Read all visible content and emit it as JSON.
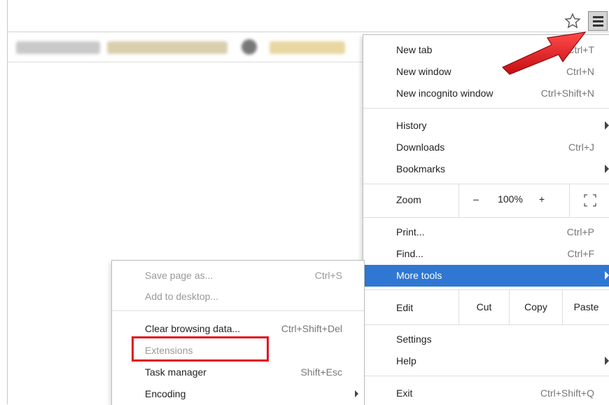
{
  "menu": {
    "items": [
      {
        "label": "New tab",
        "shortcut": "Ctrl+T"
      },
      {
        "label": "New window",
        "shortcut": "Ctrl+N"
      },
      {
        "label": "New incognito window",
        "shortcut": "Ctrl+Shift+N"
      },
      {
        "label": "History",
        "shortcut": ""
      },
      {
        "label": "Downloads",
        "shortcut": "Ctrl+J"
      },
      {
        "label": "Bookmarks",
        "shortcut": ""
      },
      {
        "label": "Print...",
        "shortcut": "Ctrl+P"
      },
      {
        "label": "Find...",
        "shortcut": "Ctrl+F"
      },
      {
        "label": "More tools",
        "shortcut": ""
      },
      {
        "label": "Settings",
        "shortcut": ""
      },
      {
        "label": "Help",
        "shortcut": ""
      },
      {
        "label": "Exit",
        "shortcut": "Ctrl+Shift+Q"
      }
    ],
    "zoom": {
      "label": "Zoom",
      "minus": "–",
      "value": "100%",
      "plus": "+"
    },
    "edit": {
      "label": "Edit",
      "cut": "Cut",
      "copy": "Copy",
      "paste": "Paste"
    }
  },
  "submenu": {
    "items": [
      {
        "label": "Save page as...",
        "shortcut": "Ctrl+S"
      },
      {
        "label": "Add to desktop...",
        "shortcut": ""
      },
      {
        "label": "Clear browsing data...",
        "shortcut": "Ctrl+Shift+Del"
      },
      {
        "label": "Extensions",
        "shortcut": ""
      },
      {
        "label": "Task manager",
        "shortcut": "Shift+Esc"
      },
      {
        "label": "Encoding",
        "shortcut": ""
      }
    ]
  },
  "icons": {
    "star": "star-outline-icon",
    "menu": "hamburger-menu-icon",
    "fullscreen": "fullscreen-icon",
    "submenu_arrow": "chevron-right-icon",
    "annotation_arrow": "red-arrow-annotation"
  },
  "colors": {
    "active_item": "#2f77d3",
    "annotation_red": "#e0131c",
    "disabled_text": "#999999"
  }
}
